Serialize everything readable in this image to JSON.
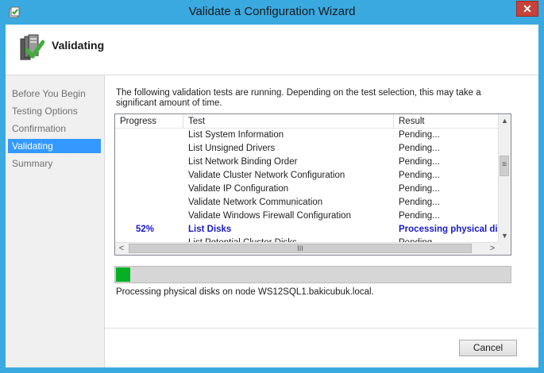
{
  "window": {
    "title": "Validate a Configuration Wizard",
    "close_glyph": "✕"
  },
  "header": {
    "title": "Validating",
    "icon": "validation-checklist-icon"
  },
  "sidebar": {
    "items": [
      {
        "label": "Before You Begin",
        "active": false
      },
      {
        "label": "Testing Options",
        "active": false
      },
      {
        "label": "Confirmation",
        "active": false
      },
      {
        "label": "Validating",
        "active": true
      },
      {
        "label": "Summary",
        "active": false
      }
    ]
  },
  "main": {
    "description": "The following validation tests are running. Depending on the test selection, this may take a significant amount of time.",
    "columns": [
      "Progress",
      "Test",
      "Result"
    ],
    "rows": [
      {
        "progress": "",
        "test": "List System Information",
        "result": "Pending..."
      },
      {
        "progress": "",
        "test": "List Unsigned Drivers",
        "result": "Pending..."
      },
      {
        "progress": "",
        "test": "List Network Binding Order",
        "result": "Pending..."
      },
      {
        "progress": "",
        "test": "Validate Cluster Network Configuration",
        "result": "Pending..."
      },
      {
        "progress": "",
        "test": "Validate IP Configuration",
        "result": "Pending..."
      },
      {
        "progress": "",
        "test": "Validate Network Communication",
        "result": "Pending..."
      },
      {
        "progress": "",
        "test": "Validate Windows Firewall Configuration",
        "result": "Pending..."
      },
      {
        "progress": "52%",
        "test": "List Disks",
        "result": "Processing physical disks",
        "active": true
      },
      {
        "progress": "",
        "test": "List Potential Cluster Disks",
        "result": "Pending..."
      }
    ],
    "scrollbar": {
      "up": "▲",
      "down": "▼",
      "left": "<",
      "right": ">",
      "grip": "≡",
      "hgrip": "III"
    },
    "progress_fraction": 0.036,
    "status_text": "Processing physical disks on node WS12SQL1.bakicubuk.local.",
    "cancel_label": "Cancel"
  },
  "colors": {
    "titlebar": "#3aa9e0",
    "selection": "#3399ff",
    "progress_fill": "#06b025",
    "active_text": "#1a1acc"
  }
}
